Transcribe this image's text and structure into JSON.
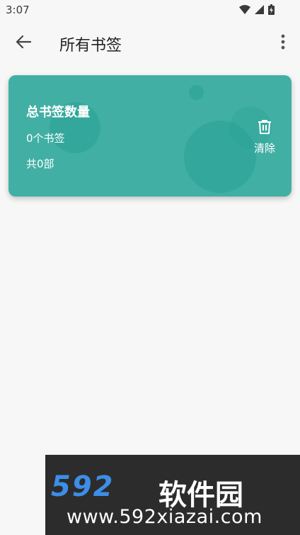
{
  "status_bar": {
    "time": "3:07"
  },
  "app_bar": {
    "title": "所有书签"
  },
  "card": {
    "title": "总书签数量",
    "count": "0个书签",
    "total": "共0部",
    "clear_label": "清除",
    "color": "#42afa4"
  },
  "watermark": {
    "logo": "592",
    "name": "软件园",
    "url": "www.592xiazai.com"
  }
}
